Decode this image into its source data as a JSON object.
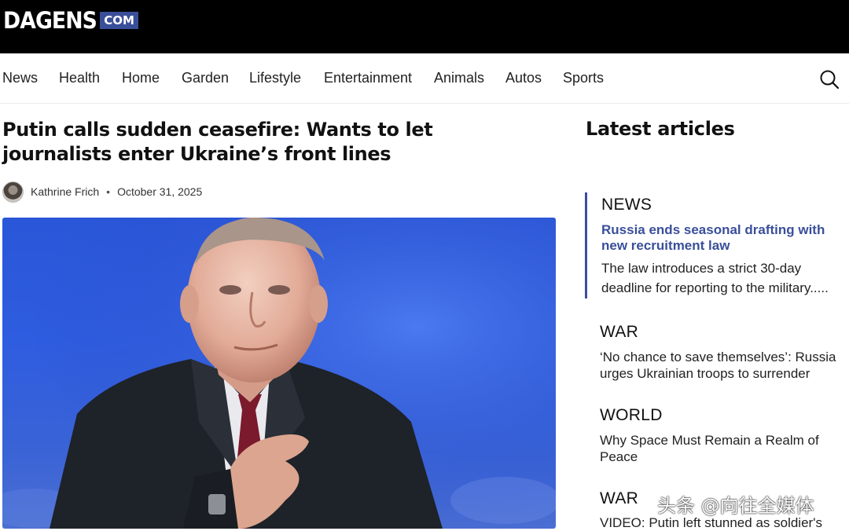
{
  "header": {
    "logo_text": "DAGENS",
    "logo_suffix": "COM"
  },
  "nav": {
    "items": [
      "News",
      "Health",
      "Home",
      "Garden",
      "Lifestyle",
      "Entertainment",
      "Animals",
      "Autos",
      "Sports"
    ]
  },
  "icons": {
    "search": "search-icon"
  },
  "article": {
    "headline": "Putin calls sudden ceasefire: Wants to let journalists enter Ukraine’s front lines",
    "author": "Kathrine Frich",
    "separator": "•",
    "date": "October 31, 2025"
  },
  "sidebar": {
    "title": "Latest articles",
    "featured": {
      "category": "NEWS",
      "title": "Russia ends seasonal drafting with new recruitment law",
      "description": "The law introduces a strict 30-day deadline for reporting to the military....."
    },
    "articles": [
      {
        "category": "WAR",
        "title": "‘No chance to save themselves’: Russia urges Ukrainian troops to surrender"
      },
      {
        "category": "WORLD",
        "title": "Why Space Must Remain a Realm of Peace"
      },
      {
        "category": "WAR",
        "title": "VIDEO: Putin left stunned as soldier's"
      }
    ]
  },
  "watermark": "头条 @向往全媒体",
  "colors": {
    "brand": "#3a4f9a",
    "header_bg": "#000000",
    "hero_bg": "#2f5de0"
  }
}
